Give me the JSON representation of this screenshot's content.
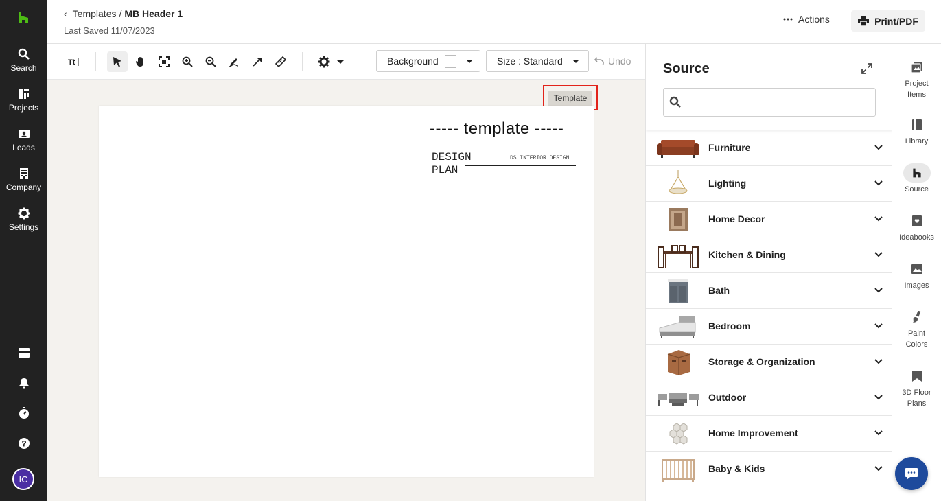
{
  "nav": {
    "items": [
      {
        "label": "Search",
        "icon": "search-icon"
      },
      {
        "label": "Projects",
        "icon": "projects-icon"
      },
      {
        "label": "Leads",
        "icon": "leads-icon"
      },
      {
        "label": "Company",
        "icon": "company-icon"
      },
      {
        "label": "Settings",
        "icon": "gear-icon"
      }
    ],
    "bottom_icons": [
      "inbox-icon",
      "bell-icon",
      "timer-icon",
      "help-icon"
    ],
    "avatar_initials": "IC"
  },
  "header": {
    "breadcrumb_parent": "Templates",
    "breadcrumb_separator": "/",
    "breadcrumb_current": "MB Header 1",
    "last_saved": "Last Saved 11/07/2023",
    "actions_label": "Actions",
    "print_label": "Print/PDF"
  },
  "toolbar": {
    "tools": [
      "text-tool-icon",
      "pointer-icon",
      "hand-icon",
      "fit-screen-icon",
      "zoom-in-icon",
      "zoom-out-icon",
      "draw-icon",
      "arrow-icon",
      "ruler-icon",
      "settings-gear-icon"
    ],
    "background_label": "Background",
    "background_color": "#ffffff",
    "size_label": "Size : Standard",
    "undo_label": "Undo"
  },
  "canvas": {
    "badge_label": "Template",
    "page_title": "----- template -----",
    "design_line1": "DESIGN",
    "design_line2": "PLAN",
    "studio_name": "DS INTERIOR DESIGN"
  },
  "source": {
    "title": "Source",
    "search_placeholder": "",
    "categories": [
      {
        "label": "Furniture"
      },
      {
        "label": "Lighting"
      },
      {
        "label": "Home Decor"
      },
      {
        "label": "Kitchen & Dining"
      },
      {
        "label": "Bath"
      },
      {
        "label": "Bedroom"
      },
      {
        "label": "Storage & Organization"
      },
      {
        "label": "Outdoor"
      },
      {
        "label": "Home Improvement"
      },
      {
        "label": "Baby & Kids"
      }
    ]
  },
  "rail": {
    "items": [
      {
        "line1": "Project",
        "line2": "Items"
      },
      {
        "line1": "Library",
        "line2": ""
      },
      {
        "line1": "Source",
        "line2": ""
      },
      {
        "line1": "Ideabooks",
        "line2": ""
      },
      {
        "line1": "Images",
        "line2": ""
      },
      {
        "line1": "Paint",
        "line2": "Colors"
      },
      {
        "line1": "3D Floor",
        "line2": "Plans"
      }
    ]
  },
  "colors": {
    "nav_bg": "#222222",
    "brand_green": "#4dbc15",
    "highlight_red": "#e2231a",
    "chat_blue": "#1e4a9c",
    "avatar_purple": "#4b2fa3"
  }
}
